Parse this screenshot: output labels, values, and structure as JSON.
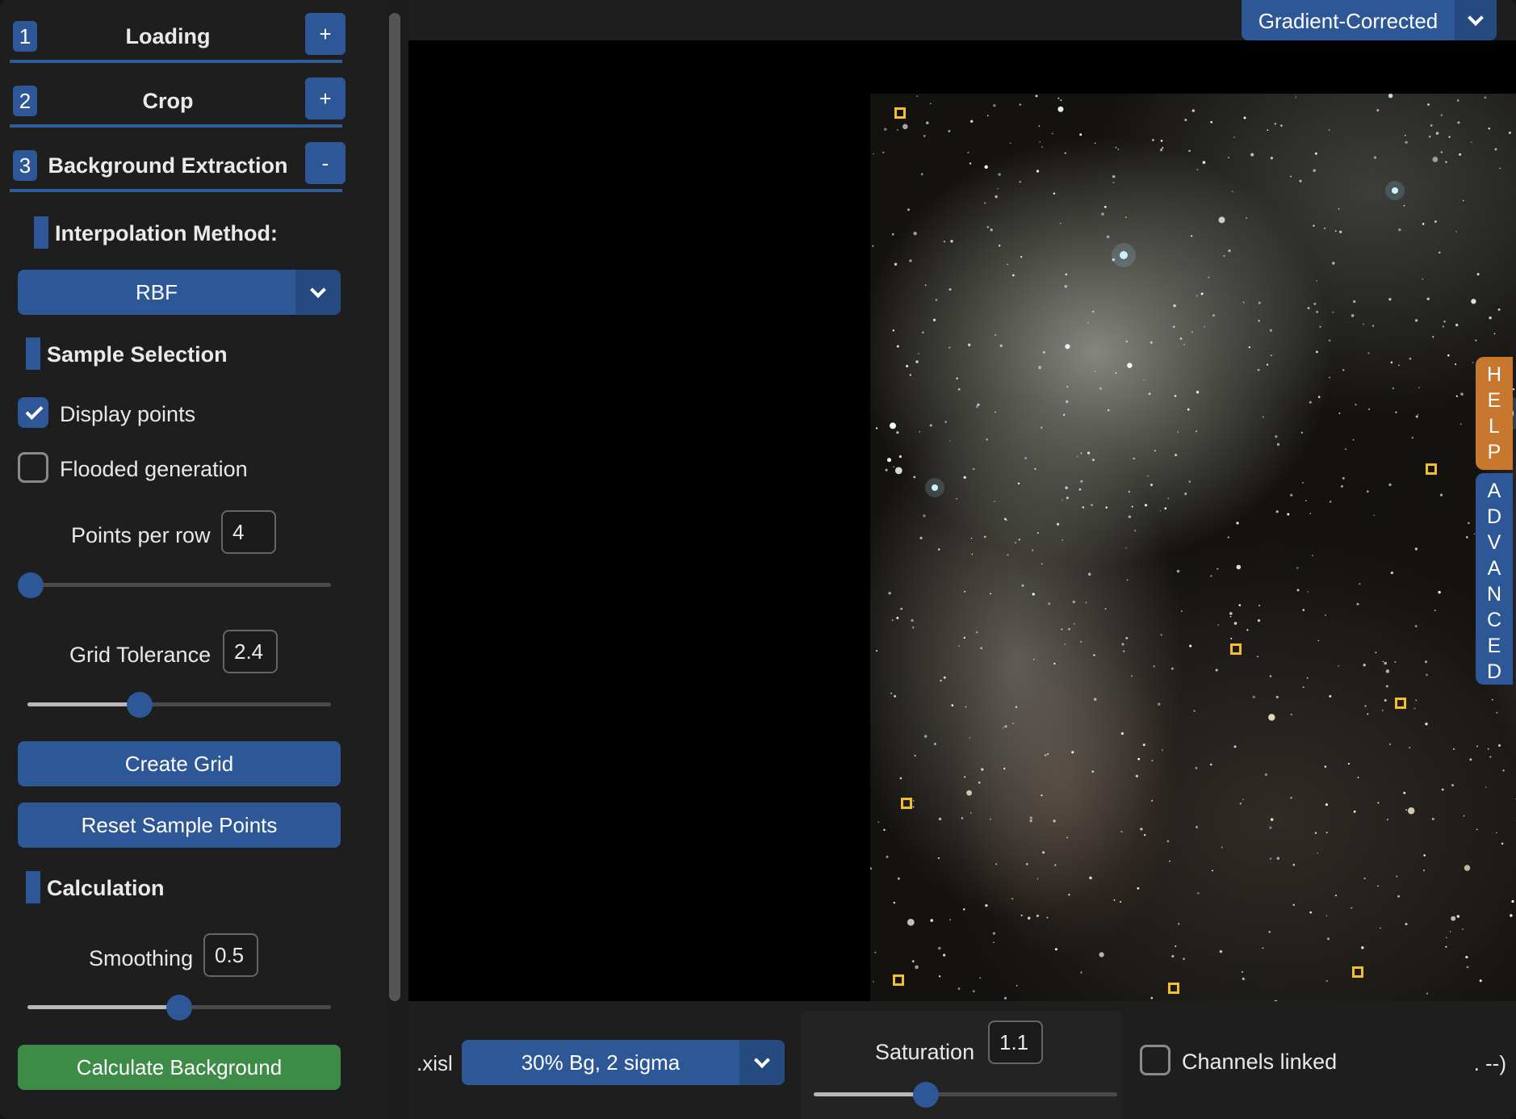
{
  "sidebar": {
    "sections": [
      {
        "num": "1",
        "title": "Loading",
        "toggle": "+"
      },
      {
        "num": "2",
        "title": "Crop",
        "toggle": "+"
      },
      {
        "num": "3",
        "title": "Background Extraction",
        "toggle": "-"
      }
    ],
    "interpolation": {
      "heading": "Interpolation Method:",
      "value": "RBF"
    },
    "sample_selection": {
      "heading": "Sample Selection",
      "display_points": {
        "label": "Display points",
        "checked": true
      },
      "flooded_generation": {
        "label": "Flooded generation",
        "checked": false
      },
      "points_per_row": {
        "label": "Points per row",
        "value": "4",
        "slider_fraction": 0.0
      },
      "grid_tolerance": {
        "label": "Grid Tolerance",
        "value": "2.4",
        "slider_fraction": 0.37
      },
      "create_grid": "Create Grid",
      "reset_points": "Reset Sample Points"
    },
    "calculation": {
      "heading": "Calculation",
      "smoothing": {
        "label": "Smoothing",
        "value": "0.5",
        "slider_fraction": 0.5
      },
      "calculate": "Calculate Background"
    }
  },
  "viewer": {
    "display_mode": "Gradient-Corrected",
    "help_tab": "HELP",
    "advanced_tab": "ADVANCED"
  },
  "bottom": {
    "left_label": ".xisl",
    "stretch": "30% Bg, 2 sigma",
    "saturation": {
      "label": "Saturation",
      "value": "1.1",
      "slider_fraction": 0.37
    },
    "channels_linked": {
      "label": "Channels linked",
      "checked": false
    },
    "tail_text": ". --)"
  },
  "colors": {
    "accent": "#2d5796",
    "green": "#3d8b47",
    "help": "#c8772e",
    "sample_point": "#f2bf2e"
  }
}
